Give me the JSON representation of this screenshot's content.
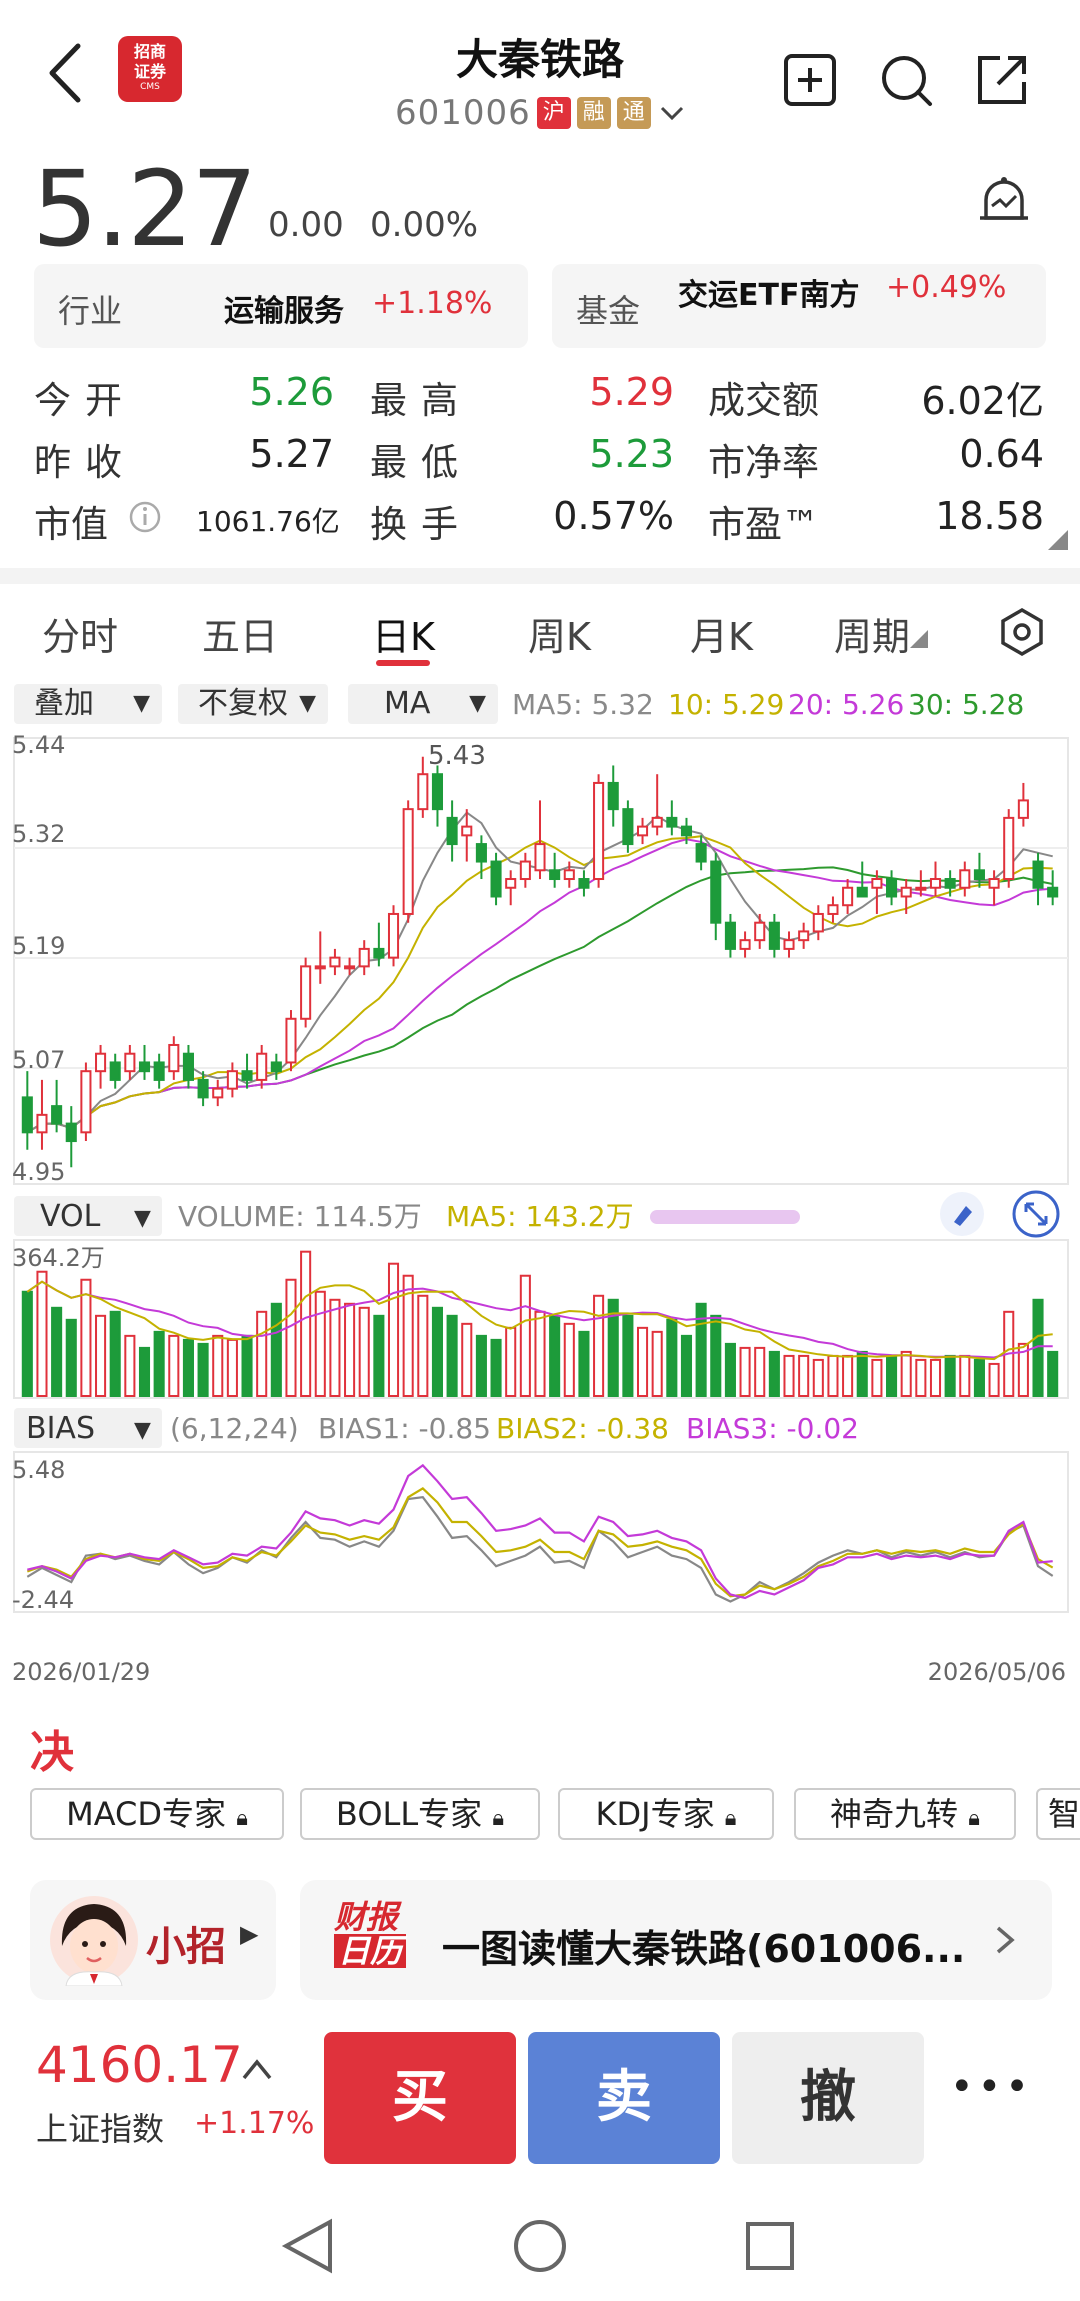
{
  "header": {
    "title": "大秦铁路",
    "code": "601006",
    "tags": [
      {
        "text": "沪",
        "color": "#e0313b"
      },
      {
        "text": "融",
        "color": "#c59a56"
      },
      {
        "text": "通",
        "color": "#c59a56"
      }
    ],
    "logo_text": "招商证券",
    "logo_sub": "CMS"
  },
  "price": {
    "last": "5.27",
    "change": "0.00",
    "change_pct": "0.00%"
  },
  "cards": {
    "industry_label": "行业",
    "industry_name": "运输服务",
    "industry_pct": "+1.18%",
    "fund_label": "基金",
    "fund_name": "交运ETF南方",
    "fund_pct": "+0.49%"
  },
  "quote": {
    "open_label": "今开",
    "open": "5.26",
    "high_label": "最高",
    "high": "5.29",
    "amount_label": "成交额",
    "amount": "6.02亿",
    "prev_label": "昨收",
    "prev": "5.27",
    "low_label": "最低",
    "low": "5.23",
    "pb_label": "市净率",
    "pb": "0.64",
    "mcap_label": "市值",
    "mcap": "1061.76亿",
    "turnover_label": "换手",
    "turnover": "0.57%",
    "pe_label": "市盈™",
    "pe": "18.58"
  },
  "tabs": [
    "分时",
    "五日",
    "日K",
    "周K",
    "月K",
    "周期"
  ],
  "toolbar": {
    "overlay": "叠加",
    "adjust": "不复权",
    "indicator": "MA",
    "ma5": "MA5: 5.32",
    "ma10": "10: 5.29",
    "ma20": "20: 5.26",
    "ma30": "30: 5.28"
  },
  "chart_labels": {
    "y_ticks": [
      "5.44",
      "5.32",
      "5.19",
      "5.07",
      "4.95"
    ],
    "peak_label": "5.43",
    "vol_selector": "VOL",
    "volume": "VOLUME: 114.5万",
    "vol_ma5": "MA5: 143.2万",
    "vol_max": "364.2万",
    "bias_selector": "BIAS",
    "bias_params": "(6,12,24)",
    "bias1": "BIAS1: -0.85",
    "bias2": "BIAS2: -0.38",
    "bias3": "BIAS3: -0.02",
    "bias_max": "5.48",
    "bias_min": "-2.44",
    "date_start": "2026/01/29",
    "date_end": "2026/05/06"
  },
  "chart_data": {
    "type": "candlestick",
    "ylim": [
      4.95,
      5.44
    ],
    "x_range": [
      "2026/01/29",
      "2026/05/06"
    ],
    "ohlc": [
      [
        5.04,
        5.07,
        4.98,
        5.0
      ],
      [
        5.0,
        5.06,
        4.98,
        5.02
      ],
      [
        5.03,
        5.06,
        5.0,
        5.01
      ],
      [
        5.01,
        5.03,
        4.96,
        4.99
      ],
      [
        5.0,
        5.08,
        4.99,
        5.07
      ],
      [
        5.07,
        5.1,
        5.05,
        5.09
      ],
      [
        5.08,
        5.09,
        5.05,
        5.06
      ],
      [
        5.07,
        5.1,
        5.06,
        5.09
      ],
      [
        5.08,
        5.1,
        5.06,
        5.07
      ],
      [
        5.08,
        5.09,
        5.05,
        5.06
      ],
      [
        5.07,
        5.11,
        5.06,
        5.1
      ],
      [
        5.09,
        5.1,
        5.05,
        5.06
      ],
      [
        5.06,
        5.07,
        5.03,
        5.04
      ],
      [
        5.04,
        5.06,
        5.03,
        5.05
      ],
      [
        5.05,
        5.08,
        5.04,
        5.07
      ],
      [
        5.07,
        5.09,
        5.05,
        5.06
      ],
      [
        5.06,
        5.1,
        5.05,
        5.09
      ],
      [
        5.08,
        5.09,
        5.06,
        5.07
      ],
      [
        5.08,
        5.14,
        5.07,
        5.13
      ],
      [
        5.13,
        5.2,
        5.12,
        5.19
      ],
      [
        5.19,
        5.23,
        5.17,
        5.19
      ],
      [
        5.19,
        5.21,
        5.18,
        5.2
      ],
      [
        5.19,
        5.2,
        5.18,
        5.19
      ],
      [
        5.19,
        5.22,
        5.18,
        5.21
      ],
      [
        5.21,
        5.24,
        5.19,
        5.2
      ],
      [
        5.2,
        5.26,
        5.19,
        5.25
      ],
      [
        5.25,
        5.38,
        5.24,
        5.37
      ],
      [
        5.37,
        5.43,
        5.36,
        5.41
      ],
      [
        5.41,
        5.42,
        5.35,
        5.37
      ],
      [
        5.36,
        5.38,
        5.31,
        5.33
      ],
      [
        5.34,
        5.37,
        5.31,
        5.35
      ],
      [
        5.33,
        5.34,
        5.29,
        5.31
      ],
      [
        5.31,
        5.32,
        5.26,
        5.27
      ],
      [
        5.28,
        5.3,
        5.26,
        5.29
      ],
      [
        5.29,
        5.32,
        5.28,
        5.31
      ],
      [
        5.3,
        5.38,
        5.29,
        5.33
      ],
      [
        5.3,
        5.32,
        5.28,
        5.29
      ],
      [
        5.29,
        5.31,
        5.28,
        5.3
      ],
      [
        5.29,
        5.3,
        5.27,
        5.28
      ],
      [
        5.29,
        5.41,
        5.28,
        5.4
      ],
      [
        5.4,
        5.42,
        5.35,
        5.37
      ],
      [
        5.37,
        5.38,
        5.32,
        5.33
      ],
      [
        5.34,
        5.36,
        5.33,
        5.35
      ],
      [
        5.35,
        5.41,
        5.34,
        5.36
      ],
      [
        5.36,
        5.38,
        5.34,
        5.35
      ],
      [
        5.35,
        5.36,
        5.33,
        5.34
      ],
      [
        5.33,
        5.34,
        5.3,
        5.31
      ],
      [
        5.31,
        5.32,
        5.22,
        5.24
      ],
      [
        5.24,
        5.25,
        5.2,
        5.21
      ],
      [
        5.21,
        5.23,
        5.2,
        5.22
      ],
      [
        5.22,
        5.25,
        5.21,
        5.24
      ],
      [
        5.24,
        5.25,
        5.2,
        5.21
      ],
      [
        5.21,
        5.23,
        5.2,
        5.22
      ],
      [
        5.22,
        5.24,
        5.21,
        5.23
      ],
      [
        5.23,
        5.26,
        5.22,
        5.25
      ],
      [
        5.25,
        5.27,
        5.24,
        5.26
      ],
      [
        5.26,
        5.29,
        5.25,
        5.28
      ],
      [
        5.28,
        5.31,
        5.27,
        5.27
      ],
      [
        5.28,
        5.3,
        5.25,
        5.29
      ],
      [
        5.29,
        5.3,
        5.26,
        5.27
      ],
      [
        5.27,
        5.29,
        5.25,
        5.28
      ],
      [
        5.28,
        5.3,
        5.27,
        5.28
      ],
      [
        5.28,
        5.31,
        5.27,
        5.29
      ],
      [
        5.29,
        5.3,
        5.27,
        5.28
      ],
      [
        5.28,
        5.31,
        5.27,
        5.3
      ],
      [
        5.3,
        5.32,
        5.28,
        5.29
      ],
      [
        5.28,
        5.3,
        5.26,
        5.29
      ],
      [
        5.29,
        5.37,
        5.28,
        5.36
      ],
      [
        5.36,
        5.4,
        5.35,
        5.38
      ],
      [
        5.31,
        5.32,
        5.26,
        5.28
      ],
      [
        5.28,
        5.3,
        5.26,
        5.27
      ]
    ],
    "volume": [
      2.6,
      3.1,
      2.2,
      1.9,
      2.9,
      2.0,
      2.1,
      1.5,
      1.2,
      1.6,
      1.5,
      1.4,
      1.3,
      1.5,
      1.4,
      1.5,
      2.1,
      2.3,
      2.9,
      3.6,
      2.6,
      2.4,
      2.3,
      2.2,
      2.0,
      3.3,
      3.0,
      2.5,
      2.2,
      2.0,
      1.8,
      1.5,
      1.4,
      1.7,
      3.0,
      2.1,
      2.0,
      1.8,
      1.6,
      2.5,
      2.4,
      2.0,
      1.7,
      1.6,
      1.9,
      1.5,
      2.3,
      2.0,
      1.3,
      1.2,
      1.2,
      1.1,
      1.0,
      1.0,
      0.9,
      1.0,
      1.0,
      1.1,
      0.9,
      1.0,
      1.1,
      0.9,
      0.9,
      1.0,
      1.0,
      0.9,
      0.8,
      2.1,
      1.3,
      2.4,
      1.1
    ],
    "bias": {
      "bias1": [
        -0.9,
        -0.4,
        -0.8,
        -1.2,
        0.3,
        0.4,
        0.1,
        0.3,
        0.0,
        -0.2,
        0.5,
        -0.2,
        -0.7,
        -0.4,
        0.2,
        -0.1,
        0.6,
        0.2,
        1.3,
        2.2,
        1.3,
        1.2,
        0.8,
        1.1,
        0.8,
        1.7,
        3.5,
        3.6,
        2.5,
        1.3,
        1.4,
        0.6,
        -0.3,
        0.0,
        0.3,
        0.8,
        -0.1,
        0.0,
        -0.4,
        1.7,
        1.1,
        0.2,
        0.5,
        0.8,
        0.3,
        0.1,
        -0.4,
        -1.9,
        -2.3,
        -1.9,
        -1.2,
        -1.6,
        -1.2,
        -0.7,
        -0.1,
        0.3,
        0.6,
        0.4,
        0.6,
        0.2,
        0.5,
        0.3,
        0.5,
        0.2,
        0.5,
        0.2,
        0.3,
        1.6,
        2.0,
        -0.3,
        -0.85
      ],
      "bias2": [
        -0.6,
        -0.3,
        -0.5,
        -0.9,
        0.1,
        0.4,
        0.2,
        0.4,
        0.1,
        0.0,
        0.5,
        0.1,
        -0.4,
        -0.3,
        0.2,
        0.0,
        0.5,
        0.3,
        1.1,
        2.0,
        1.6,
        1.5,
        1.2,
        1.4,
        1.2,
        1.9,
        3.6,
        4.1,
        3.3,
        2.2,
        2.2,
        1.4,
        0.5,
        0.6,
        0.8,
        1.2,
        0.5,
        0.5,
        0.1,
        1.7,
        1.5,
        0.8,
        0.9,
        1.1,
        0.8,
        0.6,
        0.1,
        -1.3,
        -2.0,
        -1.9,
        -1.4,
        -1.6,
        -1.3,
        -0.9,
        -0.3,
        0.0,
        0.4,
        0.4,
        0.6,
        0.4,
        0.6,
        0.5,
        0.6,
        0.4,
        0.7,
        0.5,
        0.5,
        1.5,
        2.1,
        0.1,
        -0.38
      ],
      "bias3": [
        -0.5,
        -0.3,
        -0.6,
        -1.0,
        0.0,
        0.3,
        0.2,
        0.4,
        0.2,
        0.1,
        0.6,
        0.2,
        -0.2,
        -0.1,
        0.4,
        0.3,
        0.8,
        0.7,
        1.6,
        2.8,
        2.4,
        2.3,
        2.0,
        2.3,
        2.1,
        2.9,
        4.8,
        5.4,
        4.5,
        3.5,
        3.6,
        2.7,
        1.7,
        1.8,
        2.0,
        2.4,
        1.6,
        1.6,
        1.1,
        2.5,
        2.2,
        1.4,
        1.5,
        1.7,
        1.3,
        1.1,
        0.6,
        -1.0,
        -1.9,
        -2.1,
        -1.7,
        -1.9,
        -1.5,
        -1.1,
        -0.4,
        -0.2,
        0.2,
        0.2,
        0.4,
        0.1,
        0.3,
        0.2,
        0.3,
        0.1,
        0.4,
        0.3,
        0.3,
        1.7,
        2.2,
        -0.1,
        -0.02
      ]
    },
    "series_colors": {
      "ma5": "#888888",
      "ma10": "#c4b200",
      "ma20": "#c43ad8",
      "ma30": "#2e9a2e",
      "up": "#e0313b",
      "down": "#1d9b3a"
    }
  },
  "tools": {
    "title": "决策工具",
    "buttons": [
      "MACD专家",
      "BOLL专家",
      "KDJ专家",
      "神奇九转",
      "智"
    ]
  },
  "ai": {
    "name": "小招",
    "calendar_label_1": "财报",
    "calendar_label_2": "日历",
    "headline": "一图读懂大秦铁路(601006..."
  },
  "trade": {
    "index_value": "4160.17",
    "index_name": "上证指数",
    "index_pct": "+1.17%",
    "buy": "买",
    "sell": "卖",
    "cancel": "撤",
    "more": "•••"
  }
}
